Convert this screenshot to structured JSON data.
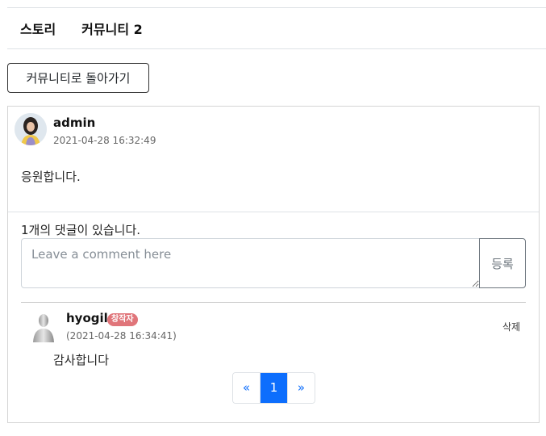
{
  "tabs": [
    {
      "label": "스토리"
    },
    {
      "label": "커뮤니티 2"
    }
  ],
  "back_button": "커뮤니티로 돌아가기",
  "post": {
    "author": "admin",
    "date": "2021-04-28 16:32:49",
    "content": "응원합니다."
  },
  "comments_section": {
    "count_text": "1개의 댓글이 있습니다.",
    "input_placeholder": "Leave a comment here",
    "submit_label": "등록"
  },
  "comments": [
    {
      "author": "hyogil",
      "badge": "창작자",
      "date": "(2021-04-28 16:34:41)",
      "delete_label": "삭제",
      "content": "감사합니다"
    }
  ],
  "pagination": {
    "prev": "«",
    "current": "1",
    "next": "»"
  },
  "colors": {
    "accent": "#0d6efd",
    "badge": "#e0757a"
  }
}
